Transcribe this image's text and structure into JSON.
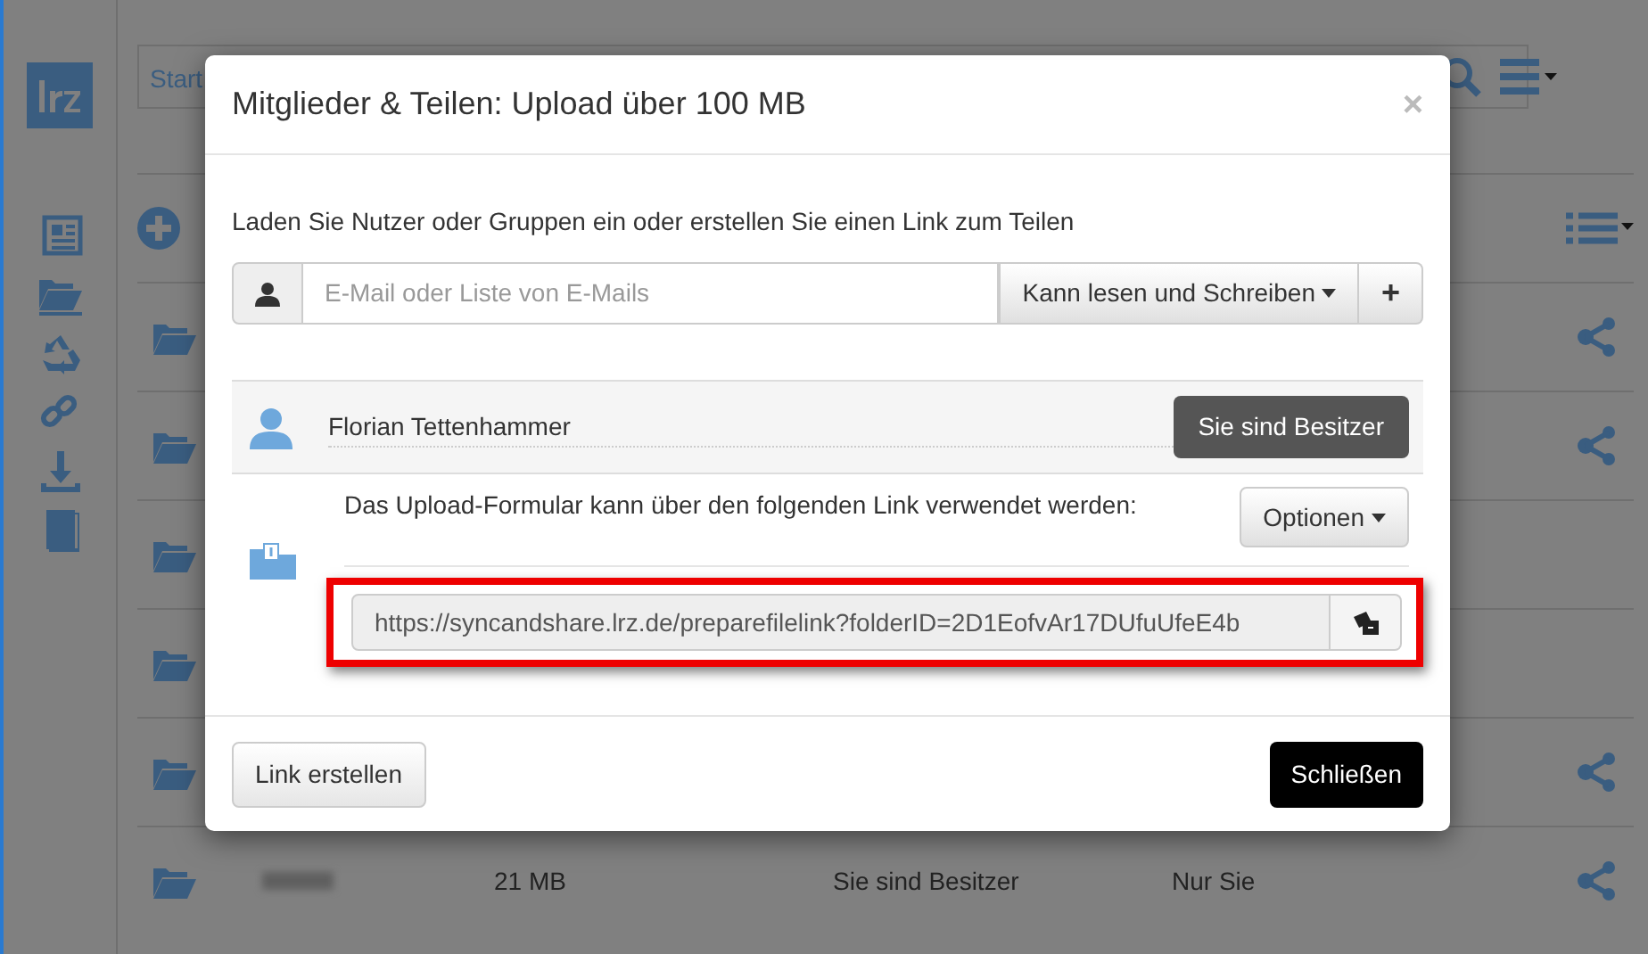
{
  "search": {
    "placeholder": "Start"
  },
  "rows": [
    {
      "share": true
    },
    {
      "share": true
    },
    {
      "share": false
    },
    {
      "share": false
    },
    {
      "share": true
    },
    {
      "share": true,
      "size": "21 MB",
      "role": "Sie sind Besitzer",
      "shared_with": "Nur Sie"
    }
  ],
  "modal": {
    "title": "Mitglieder & Teilen: Upload über 100 MB",
    "close": "×",
    "intro": "Laden Sie Nutzer oder Gruppen ein oder erstellen Sie einen Link zum Teilen",
    "invite": {
      "placeholder": "E-Mail oder Liste von E-Mails",
      "permission": "Kann lesen und Schreiben",
      "add": "+"
    },
    "owner": {
      "name": "Florian Tettenhammer",
      "badge": "Sie sind Besitzer"
    },
    "upload_link": {
      "text": "Das Upload-Formular kann über den folgenden Link verwendet werden:",
      "options": "Optionen",
      "url": "https://syncandshare.lrz.de/preparefilelink?folderID=2D1EofvAr17DUfuUfeE4b",
      "highlighted": true
    },
    "buttons": [
      {
        "label": "Link erstellen",
        "kind": "secondary"
      },
      {
        "label": "Schließen",
        "kind": "primary"
      }
    ]
  }
}
